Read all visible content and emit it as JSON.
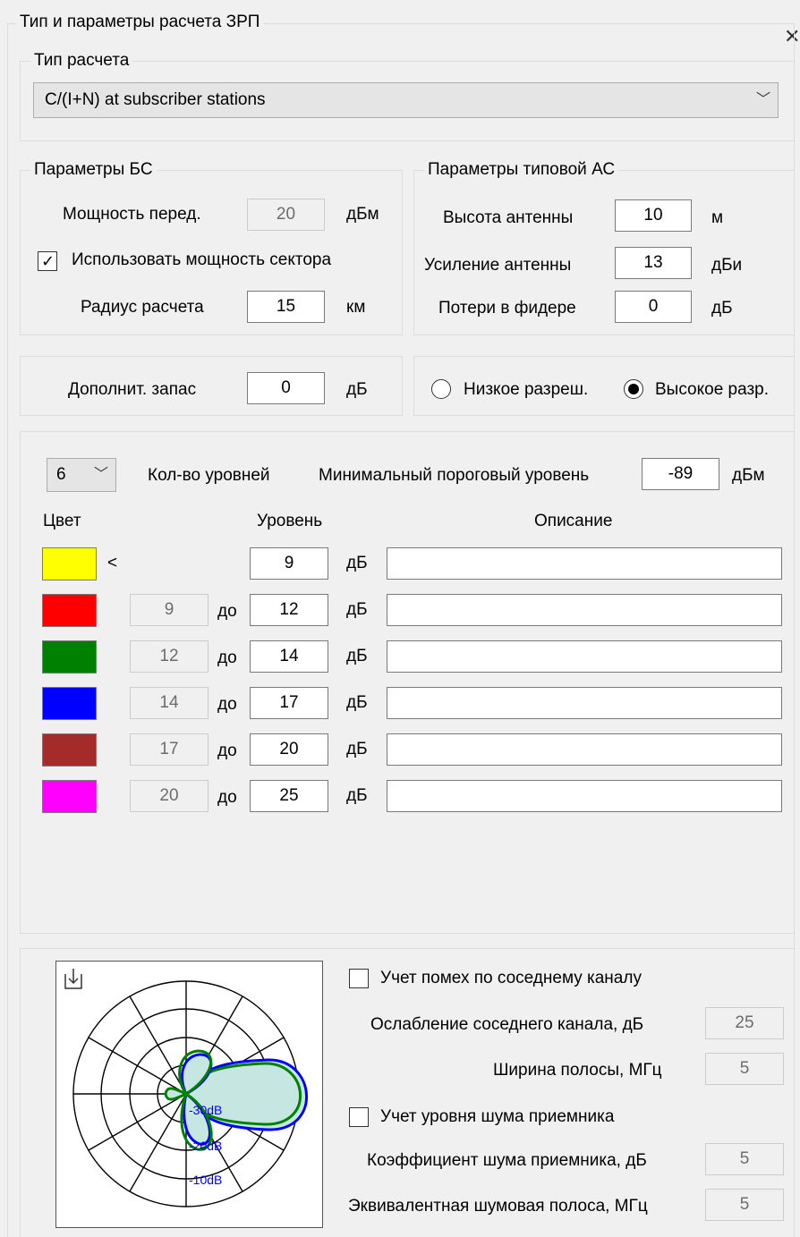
{
  "main_group": {
    "title": "Тип и параметры расчета ЗРП"
  },
  "calc_type": {
    "title": "Тип расчета",
    "selected": "C/(I+N) at subscriber stations",
    "chevron_icon": "chevron-down-icon"
  },
  "bs_params": {
    "title": "Параметры БС",
    "power_label": "Мощность перед.",
    "power_value": "20",
    "power_unit": "дБм",
    "use_sector_label": "Использовать мощность сектора",
    "use_sector_checked": true,
    "radius_label": "Радиус расчета",
    "radius_value": "15",
    "radius_unit": "км"
  },
  "ms_params": {
    "title": "Параметры типовой АС",
    "height_label": "Высота антенны",
    "height_value": "10",
    "height_unit": "м",
    "gain_label": "Усиление антенны",
    "gain_value": "13",
    "gain_unit": "дБи",
    "loss_label": "Потери в фидере",
    "loss_value": "0",
    "loss_unit": "дБ"
  },
  "margin": {
    "label": "Дополнит. запас",
    "value": "0",
    "unit": "дБ"
  },
  "resolution": {
    "low_label": "Низкое разреш.",
    "high_label": "Высокое разр.",
    "selected": "high"
  },
  "levels": {
    "count_value": "6",
    "count_label": "Кол-во уровней",
    "min_label": "Минимальный пороговый уровень",
    "min_value": "-89",
    "min_unit": "дБм",
    "header_color": "Цвет",
    "header_level": "Уровень",
    "header_desc": "Описание",
    "lt_symbol": "<",
    "to_label": "до",
    "unit": "дБ",
    "rows": [
      {
        "color": "#ffff00",
        "from": "",
        "to": "9",
        "desc": ""
      },
      {
        "color": "#ff0000",
        "from": "9",
        "to": "12",
        "desc": ""
      },
      {
        "color": "#008000",
        "from": "12",
        "to": "14",
        "desc": ""
      },
      {
        "color": "#0000ff",
        "from": "14",
        "to": "17",
        "desc": ""
      },
      {
        "color": "#a52a2a",
        "from": "17",
        "to": "20",
        "desc": ""
      },
      {
        "color": "#ff00ff",
        "from": "20",
        "to": "25",
        "desc": ""
      }
    ]
  },
  "interference": {
    "adjacent_label": "Учет помех по соседнему каналу",
    "adjacent_checked": false,
    "acir_label": "Ослабление соседнего канала, дБ",
    "acir_value": "25",
    "bw_label": "Ширина полосы, МГц",
    "bw_value": "5",
    "noise_label": "Учет уровня шума приемника",
    "noise_checked": false,
    "nf_label": "Коэффициент шума приемника, дБ",
    "nf_value": "5",
    "nbw_label": "Эквивалентная шумовая полоса, МГц",
    "nbw_value": "5"
  },
  "pattern": {
    "ring_labels": [
      "-30dB",
      "-20dB",
      "-10dB"
    ],
    "download_icon": "download-icon",
    "colors": {
      "blue": "#0000ff",
      "green": "#008000",
      "fill": "#c6e6e2"
    }
  }
}
